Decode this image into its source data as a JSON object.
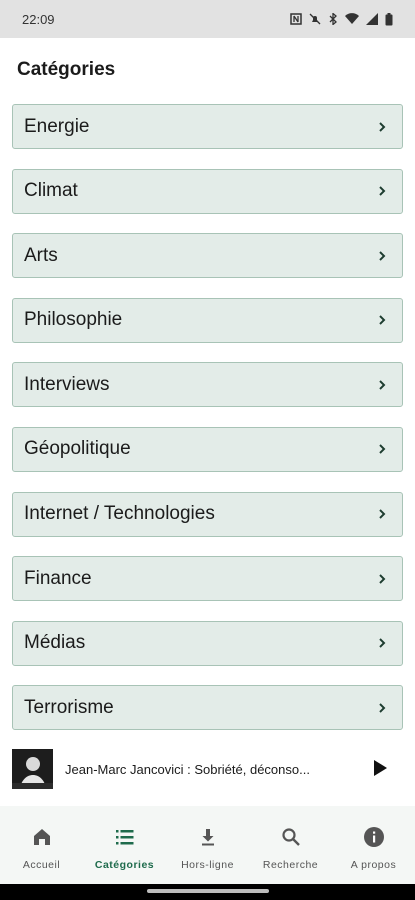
{
  "status_bar": {
    "time": "22:09",
    "icons": [
      "nfc-icon",
      "mute-icon",
      "bluetooth-icon",
      "wifi-icon",
      "signal-icon",
      "battery-icon"
    ]
  },
  "page": {
    "title": "Catégories"
  },
  "categories": [
    {
      "label": "Energie"
    },
    {
      "label": "Climat"
    },
    {
      "label": "Arts"
    },
    {
      "label": "Philosophie"
    },
    {
      "label": "Interviews"
    },
    {
      "label": "Géopolitique"
    },
    {
      "label": "Internet / Technologies"
    },
    {
      "label": "Finance"
    },
    {
      "label": "Médias"
    },
    {
      "label": "Terrorisme"
    }
  ],
  "player": {
    "title": "Jean-Marc Jancovici : Sobriété, déconso...",
    "play_icon": "play-icon"
  },
  "nav": {
    "items": [
      {
        "label": "Accueil",
        "icon": "home-icon"
      },
      {
        "label": "Catégories",
        "icon": "list-icon",
        "active": true
      },
      {
        "label": "Hors-ligne",
        "icon": "download-icon"
      },
      {
        "label": "Recherche",
        "icon": "search-icon"
      },
      {
        "label": "A propos",
        "icon": "info-icon"
      }
    ]
  },
  "colors": {
    "accent": "#1e6b4c",
    "item_bg": "#e3ece8",
    "item_border": "#a8c3b6",
    "nav_bg": "#f4f7f5"
  }
}
